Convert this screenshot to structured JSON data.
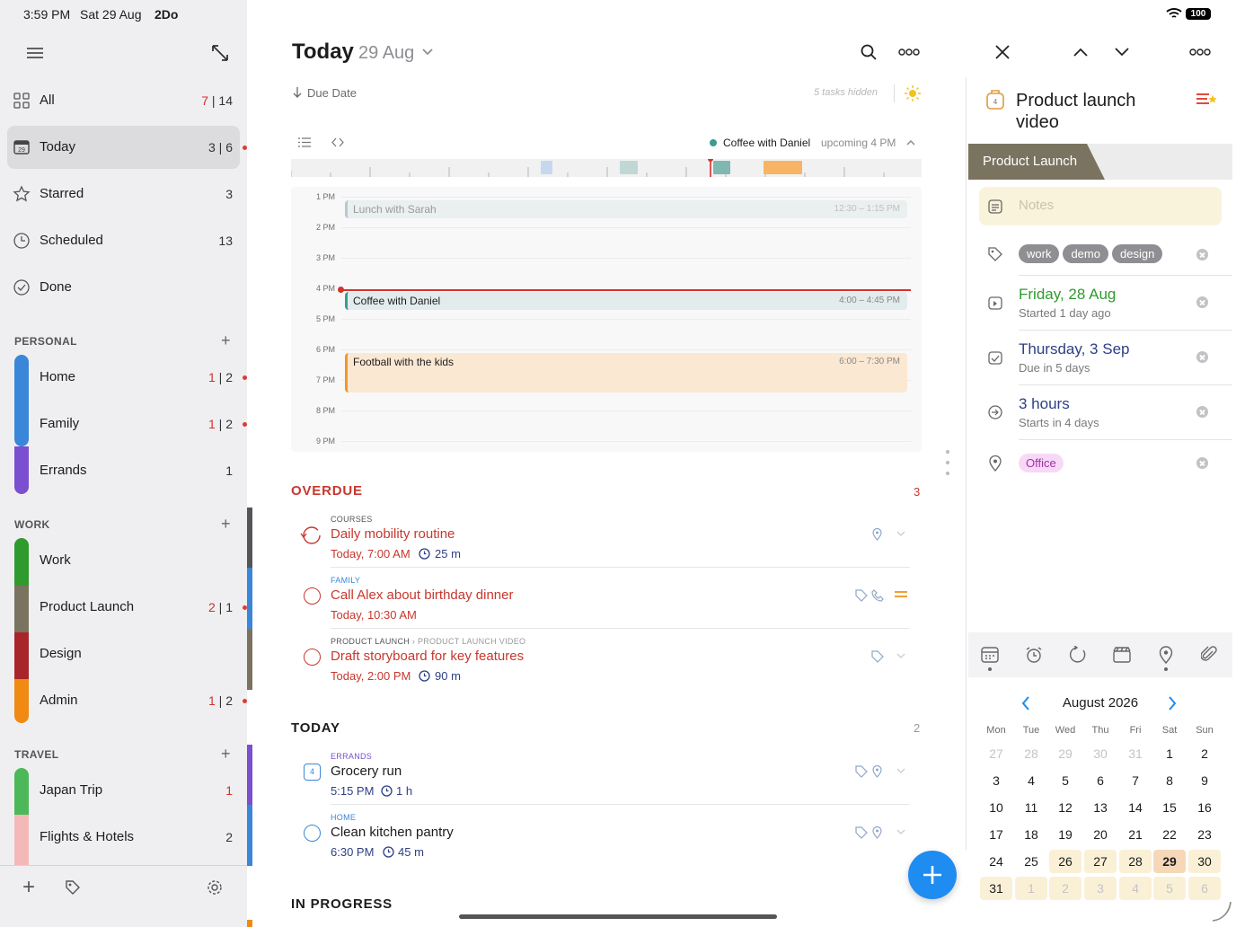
{
  "status_bar": {
    "time": "3:59 PM",
    "date": "Sat 29 Aug",
    "app": "2Do",
    "battery": "100"
  },
  "sidebar": {
    "smart_lists": [
      {
        "label": "All",
        "count_red": "7",
        "sep": " | ",
        "count": "14",
        "icon": "grid-icon"
      },
      {
        "label": "Today",
        "count_red": "",
        "sep": "",
        "count": "3 | 6",
        "icon": "calendar-today-icon"
      },
      {
        "label": "Starred",
        "count_red": "",
        "sep": "",
        "count": "3",
        "icon": "star-icon"
      },
      {
        "label": "Scheduled",
        "count_red": "",
        "sep": "",
        "count": "13",
        "icon": "clock-icon"
      },
      {
        "label": "Done",
        "count_red": "",
        "sep": "",
        "count": "",
        "icon": "check-circle-icon"
      }
    ],
    "sections": [
      {
        "title": "PERSONAL",
        "lists": [
          {
            "label": "Home",
            "count_red": "1",
            "sep": " | ",
            "count": "2",
            "color": "#3a86d8"
          },
          {
            "label": "Family",
            "count_red": "1",
            "sep": " | ",
            "count": "2",
            "color": "#3a86d8"
          },
          {
            "label": "Errands",
            "count_red": "",
            "sep": "",
            "count": "1",
            "color": "#7a4fd0"
          }
        ]
      },
      {
        "title": "WORK",
        "lists": [
          {
            "label": "Work",
            "count_red": "",
            "sep": "",
            "count": "",
            "color": "#2f9a2e"
          },
          {
            "label": "Product Launch",
            "count_red": "2",
            "sep": " | ",
            "count": "1",
            "color": "#7a7360"
          },
          {
            "label": "Design",
            "count_red": "",
            "sep": "",
            "count": "",
            "color": "#a8262a"
          },
          {
            "label": "Admin",
            "count_red": "1",
            "sep": " | ",
            "count": "2",
            "color": "#f08a12"
          }
        ]
      },
      {
        "title": "TRAVEL",
        "lists": [
          {
            "label": "Japan Trip",
            "count_red": "1",
            "sep": "",
            "count": "",
            "color": "#4cb85a"
          },
          {
            "label": "Flights & Hotels",
            "count_red": "",
            "sep": "",
            "count": "2",
            "color": "#f4b8b8"
          }
        ]
      }
    ]
  },
  "main": {
    "title": "Today",
    "date": "29 Aug",
    "sort": "Due Date",
    "hidden": "5 tasks hidden",
    "next_event": "Coffee with Daniel",
    "next_event_time": "upcoming 4 PM",
    "timeline_hours": [
      "1 PM",
      "2 PM",
      "3 PM",
      "4 PM",
      "5 PM",
      "6 PM",
      "7 PM",
      "8 PM",
      "9 PM"
    ],
    "events": [
      {
        "title": "Lunch with Sarah",
        "time": "12:30 – 1:15 PM"
      },
      {
        "title": "Coffee with Daniel",
        "time": "4:00 – 4:45 PM"
      },
      {
        "title": "Football with the kids",
        "time": "6:00 – 7:30 PM"
      }
    ],
    "overdue": {
      "title": "OVERDUE",
      "count": "3",
      "tasks": [
        {
          "category": "COURSES",
          "title": "Daily mobility routine",
          "due": "Today, 7:00 AM",
          "duration": "25 m"
        },
        {
          "category": "FAMILY",
          "title": "Call Alex about birthday dinner",
          "due": "Today, 10:30 AM",
          "duration": ""
        },
        {
          "category": "PRODUCT LAUNCH",
          "subcategory": "PRODUCT LAUNCH VIDEO",
          "title": "Draft storyboard for key features",
          "due": "Today, 2:00 PM",
          "duration": "90 m"
        }
      ]
    },
    "today": {
      "title": "TODAY",
      "count": "2",
      "tasks": [
        {
          "category": "ERRANDS",
          "title": "Grocery run",
          "due": "5:15 PM",
          "duration": "1 h"
        },
        {
          "category": "HOME",
          "title": "Clean kitchen pantry",
          "due": "6:30 PM",
          "duration": "45 m"
        }
      ]
    },
    "in_progress": {
      "title": "IN PROGRESS"
    }
  },
  "detail": {
    "title_line1": "Product launch",
    "title_line2": "video",
    "project": "Product Launch",
    "notes_placeholder": "Notes",
    "tags": [
      "work",
      "demo",
      "design"
    ],
    "start_date": "Friday, 28 Aug",
    "start_sub": "Started 1 day ago",
    "due_date": "Thursday, 3 Sep",
    "due_sub": "Due in 5 days",
    "duration": "3 hours",
    "duration_sub": "Starts in 4 days",
    "location": "Office",
    "calendar": {
      "month": "August 2026",
      "dow": [
        "Mon",
        "Tue",
        "Wed",
        "Thu",
        "Fri",
        "Sat",
        "Sun"
      ],
      "days": [
        [
          "27",
          "28",
          "29",
          "30",
          "31",
          "1",
          "2"
        ],
        [
          "3",
          "4",
          "5",
          "6",
          "7",
          "8",
          "9"
        ],
        [
          "10",
          "11",
          "12",
          "13",
          "14",
          "15",
          "16"
        ],
        [
          "17",
          "18",
          "19",
          "20",
          "21",
          "22",
          "23"
        ],
        [
          "24",
          "25",
          "26",
          "27",
          "28",
          "29",
          "30"
        ],
        [
          "31",
          "1",
          "2",
          "3",
          "4",
          "5",
          "6"
        ]
      ]
    }
  },
  "colors": {
    "accent": "#1e8cf0",
    "overdue": "#c8372d",
    "project": "#7a7360",
    "notes_bg": "#faf3dc"
  }
}
